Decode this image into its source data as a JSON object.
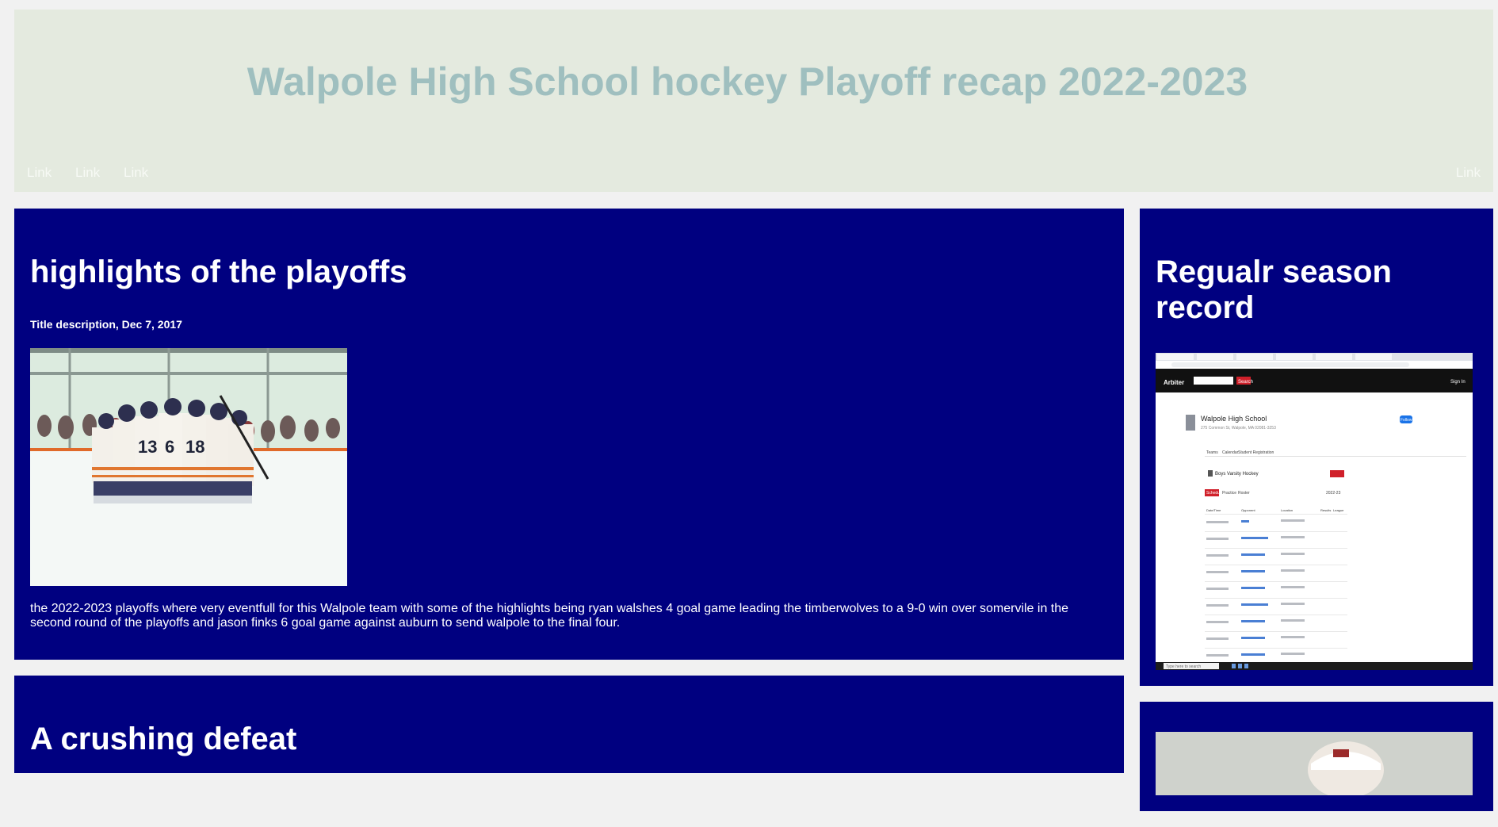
{
  "header": {
    "title": "Walpole High School hockey Playoff recap 2022-2023",
    "nav_left": [
      "Link",
      "Link",
      "Link"
    ],
    "nav_right": "Link"
  },
  "main": {
    "posts": [
      {
        "heading": "highlights of the playoffs",
        "subheading": "Title description, Dec 7, 2017",
        "body": "the 2022-2023 playoffs where very eventfull for this Walpole team with some of the highlights being ryan walshes 4 goal game leading the timberwolves to a 9-0 win over somervile in the second round of the playoffs and jason finks 6 goal game against auburn to send walpole to the final four."
      },
      {
        "heading": "A crushing defeat"
      }
    ]
  },
  "sidebar": {
    "card_title": "Regualr season record",
    "screenshot": {
      "search_button": "Search",
      "sign_in": "Sign In",
      "school_name": "Walpole High School",
      "school_address": "275 Common St, Walpole, MA 02081-3253",
      "follow_button": "Follow",
      "tabs": [
        "Teams",
        "Calendar",
        "Student Registration"
      ],
      "team_name": "Boys Varsity Hockey",
      "season_tabs": [
        "Schedule",
        "Practice",
        "Roster"
      ],
      "year_select": "2022-23",
      "columns": [
        "Date/Time",
        "Opponent",
        "Location",
        "Results",
        "League"
      ],
      "taskbar_search": "Type here to search"
    }
  },
  "colors": {
    "header_bg": "#e4eadf",
    "title": "#9fbfbf",
    "card_bg": "#000080",
    "page_bg": "#f1f1f1"
  }
}
